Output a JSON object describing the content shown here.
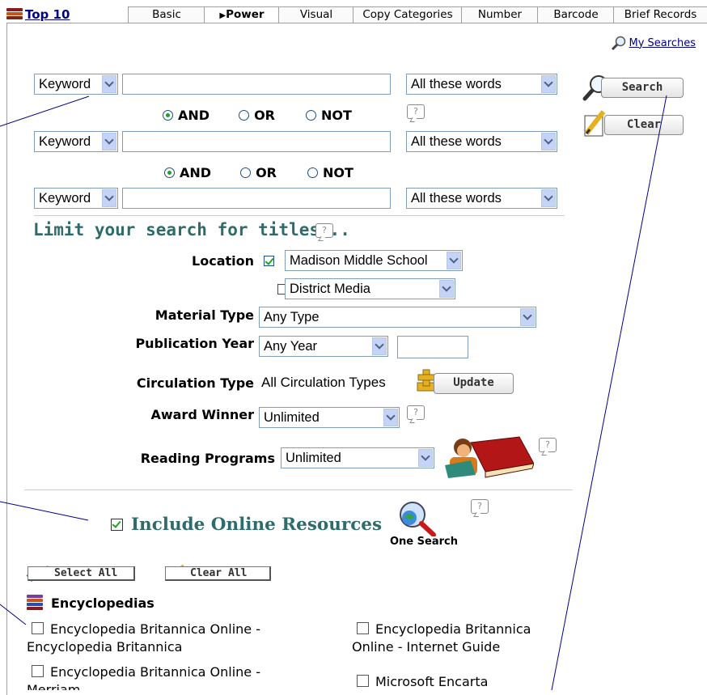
{
  "nav": {
    "top10": "Top 10",
    "tabs": [
      "Basic",
      "Power",
      "Visual",
      "Copy Categories",
      "Number",
      "Barcode",
      "Brief Records"
    ],
    "active_tab": "Power",
    "my_searches": "My Searches"
  },
  "search": {
    "rows": [
      {
        "field": "Keyword",
        "value": "",
        "match": "All these words"
      },
      {
        "field": "Keyword",
        "value": "",
        "match": "All these words"
      },
      {
        "field": "Keyword",
        "value": "",
        "match": "All these words"
      }
    ],
    "operators": [
      "AND",
      "OR",
      "NOT"
    ],
    "operator_selected": "AND",
    "help": "?",
    "search_button": "Search",
    "clear_button": "Clear"
  },
  "limit": {
    "heading": "Limit your search for titles...",
    "location_label": "Location",
    "location1": "Madison Middle School",
    "location1_checked": true,
    "location2": "District Media",
    "location2_checked": false,
    "material_label": "Material Type",
    "material_value": "Any Type",
    "pubyear_label": "Publication Year",
    "pubyear_value": "Any Year",
    "pubyear_input": "",
    "circ_label": "Circulation Type",
    "circ_value": "All Circulation Types",
    "update_button": "Update",
    "award_label": "Award Winner",
    "award_value": "Unlimited",
    "reading_label": "Reading Programs",
    "reading_value": "Unlimited"
  },
  "online": {
    "label": "Include Online Resources",
    "checked": true,
    "one_search": "One Search",
    "select_all": "Select All",
    "clear_all": "Clear All",
    "category": "Encyclopedias",
    "resources": [
      {
        "line1": "Encyclopedia Britannica Online -",
        "line2": "Encyclopedia Britannica"
      },
      {
        "line1": "Encyclopedia Britannica",
        "line2": "Online - Internet Guide"
      },
      {
        "line1": "Encyclopedia Britannica Online -",
        "line2": "Merriam..."
      },
      {
        "line1": "Microsoft Encarta",
        "line2": ""
      }
    ]
  },
  "colors": {
    "heading": "#2f6b6b",
    "link": "#00008b",
    "check": "#21a121",
    "select_border": "#7f9db9"
  }
}
